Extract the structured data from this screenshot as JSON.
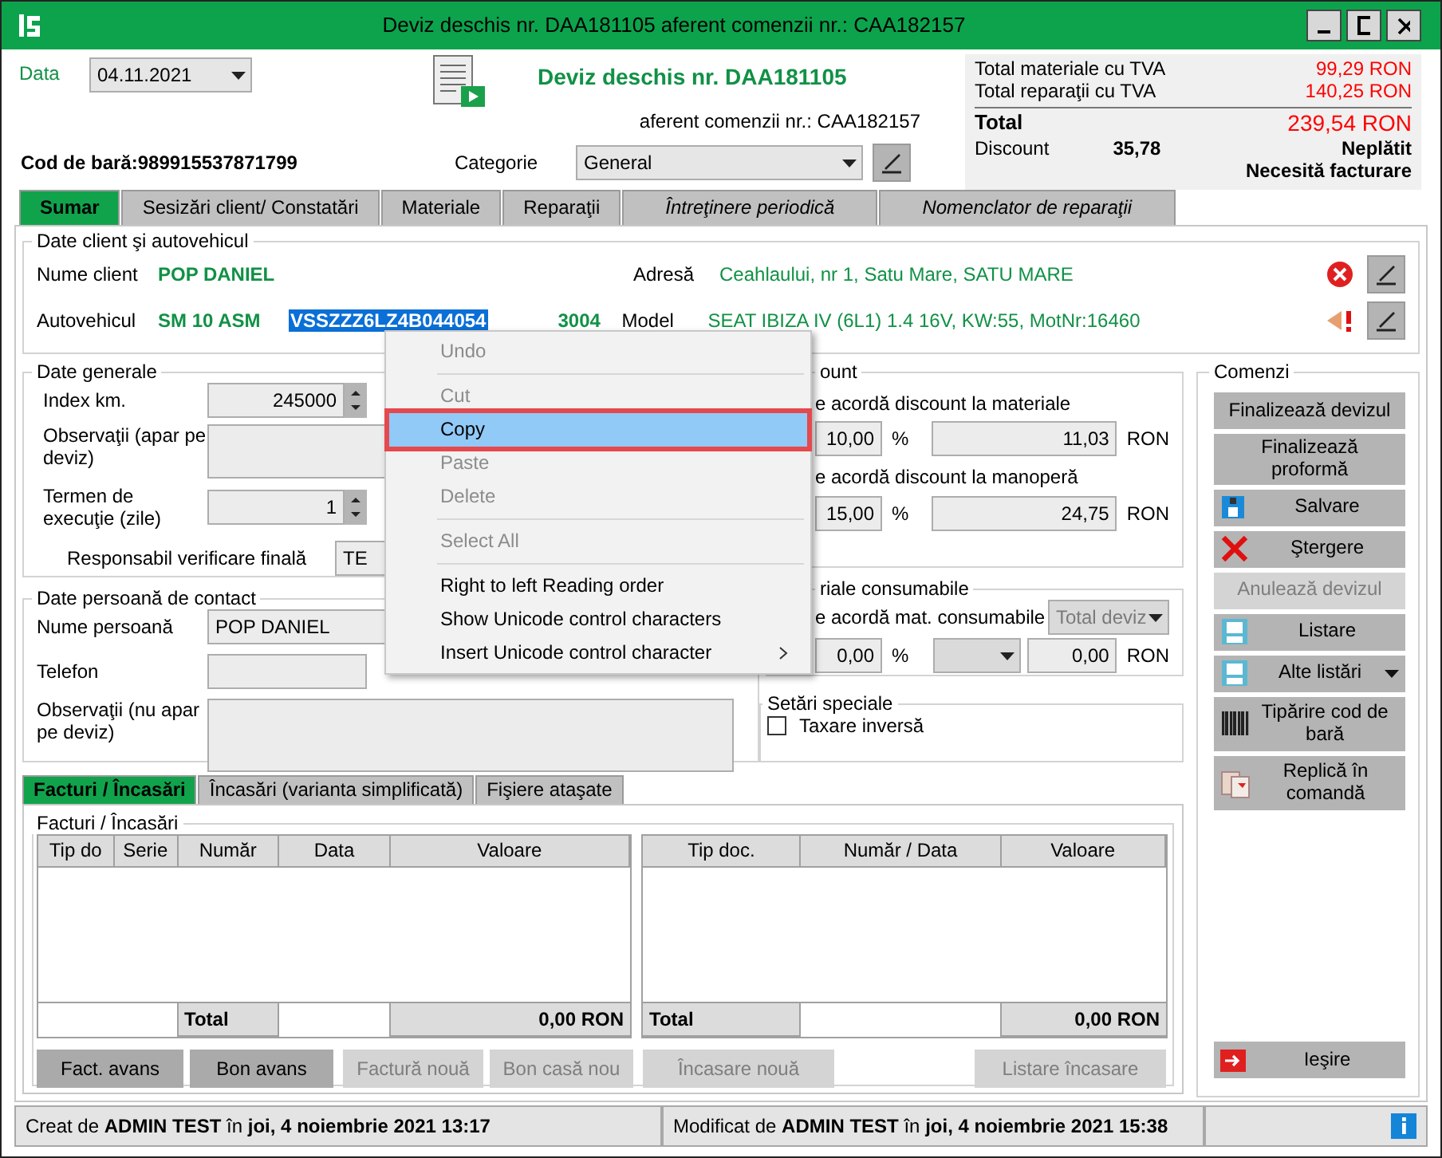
{
  "window": {
    "title": "Deviz deschis nr. DAA181105 aferent comenzii nr.: CAA182157"
  },
  "header": {
    "date_label": "Data",
    "date": "04.11.2021",
    "doc_title": "Deviz deschis nr. DAA181105",
    "order_ref": "aferent comenzii nr.: CAA182157",
    "barcode": "Cod de bară:989915537871799",
    "category_label": "Categorie",
    "category": "General"
  },
  "totals": {
    "rows": [
      {
        "label": "Total materiale cu TVA",
        "value": "99,29 RON"
      },
      {
        "label": "Total reparaţii cu TVA",
        "value": "140,25 RON"
      }
    ],
    "total_label": "Total",
    "total": "239,54 RON",
    "discount_label": "Discount",
    "discount": "35,78",
    "payment_status": "Neplătit",
    "invoice_note": "Necesită facturare"
  },
  "tabs": [
    {
      "label": "Sumar",
      "selected": true,
      "kind": "plain"
    },
    {
      "label": "Sesizări client/ Constatări",
      "selected": false,
      "kind": "plain"
    },
    {
      "label": "Materiale",
      "selected": false,
      "kind": "plain"
    },
    {
      "label": "Reparaţii",
      "selected": false,
      "kind": "plain"
    },
    {
      "label": "Întreţinere periodică",
      "selected": false,
      "kind": "italic"
    },
    {
      "label": "Nomenclator de reparaţii",
      "selected": false,
      "kind": "italic"
    }
  ],
  "client": {
    "title": "Date client şi autovehicul",
    "name_label": "Nume client",
    "name": "POP DANIEL",
    "address_label": "Adresă",
    "address": "Ceahlaului, nr 1, Satu Mare, SATU MARE",
    "vehicle_label": "Autovehicul",
    "plate": "SM 10 ASM",
    "vin": "VSSZZZ6LZ4B044054",
    "vin_selected": true,
    "year": "3004",
    "model_label": "Model",
    "model": "SEAT IBIZA IV (6L1) 1.4 16V, KW:55, MotNr:16460"
  },
  "general": {
    "title": "Date generale",
    "km_label": "Index km.",
    "km": "245000",
    "notes_label": "Observaţii (apar pe deviz)",
    "term_label": "Termen de execuţie (zile)",
    "term": "1",
    "checker_label": "Responsabil verificare finală",
    "checker": "TE"
  },
  "contact": {
    "title": "Date persoană de contact",
    "name_label": "Nume persoană",
    "name": "POP DANIEL",
    "phone_label": "Telefon",
    "notes_label": "Observaţii (nu apar pe deviz)"
  },
  "discount": {
    "title": "ount",
    "rows": [
      {
        "label": "e acordă discount la materiale",
        "percent": "10,00",
        "unit": "%",
        "amount": "11,03",
        "currency": "RON"
      },
      {
        "label": "e acordă discount la manoperă",
        "percent": "15,00",
        "unit": "%",
        "amount": "24,75",
        "currency": "RON"
      }
    ]
  },
  "consumables": {
    "title": "riale consumabile",
    "label": "e acordă mat. consumabile",
    "basis": "Total deviz",
    "percent": "0,00",
    "unit": "%",
    "amount": "0,00",
    "currency": "RON",
    "disabled": true
  },
  "special": {
    "title": "Setări speciale",
    "reverse_charge": {
      "label": "Taxare inversă",
      "checked": false
    }
  },
  "commands": {
    "title": "Comenzi",
    "buttons": [
      {
        "label": "Finalizează devizul",
        "kind": "plain",
        "disabled": false
      },
      {
        "label": "Finalizează proformă",
        "kind": "plain",
        "disabled": false
      },
      {
        "label": "Salvare",
        "kind": "save",
        "disabled": false
      },
      {
        "label": "Ştergere",
        "kind": "delete",
        "disabled": false
      },
      {
        "label": "Anulează devizul",
        "kind": "plain",
        "disabled": true
      },
      {
        "label": "Listare",
        "kind": "print",
        "disabled": false
      },
      {
        "label": "Alte listări",
        "kind": "print_menu",
        "disabled": false
      },
      {
        "label": "Tipărire cod de bară",
        "kind": "barcode",
        "disabled": false
      },
      {
        "label": "Replică în comandă",
        "kind": "copy",
        "disabled": false
      }
    ],
    "exit": {
      "label": "Ieşire"
    }
  },
  "bottom_tabs": [
    {
      "label": "Facturi / Încasări",
      "selected": true
    },
    {
      "label": "Încasări (varianta simplificată)",
      "selected": false
    },
    {
      "label": "Fişiere ataşate",
      "selected": false
    }
  ],
  "invoices": {
    "title": "Facturi / Încasări",
    "left_table": {
      "columns": [
        "Tip do",
        "Serie",
        "Număr",
        "Data",
        "Valoare"
      ],
      "total_label": "Total",
      "total": "0,00 RON"
    },
    "right_table": {
      "columns": [
        "Tip doc.",
        "Număr / Data",
        "Valoare"
      ],
      "total_label": "Total",
      "total": "0,00 RON"
    },
    "buttons": [
      {
        "label": "Fact. avans",
        "disabled": false
      },
      {
        "label": "Bon avans",
        "disabled": false
      },
      {
        "label": "Factură nouă",
        "disabled": true
      },
      {
        "label": "Bon casă nou",
        "disabled": true
      },
      {
        "label": "Încasare nouă",
        "disabled": true
      },
      {
        "label": "Listare încasare",
        "disabled": true
      }
    ]
  },
  "status_bar": {
    "created": "Creat de **ADMIN TEST** în **joi, 4 noiembrie 2021 13:17**",
    "modified": "Modificat de **ADMIN TEST** în **joi, 4 noiembrie 2021 15:38**"
  },
  "context_menu": {
    "items": [
      {
        "kind": "item",
        "label": "Undo",
        "disabled": true,
        "selected": false,
        "marked": false,
        "submenu": false
      },
      {
        "kind": "separator"
      },
      {
        "kind": "item",
        "label": "Cut",
        "disabled": true,
        "selected": false,
        "marked": false,
        "submenu": false
      },
      {
        "kind": "item",
        "label": "Copy",
        "disabled": false,
        "selected": true,
        "marked": true,
        "submenu": false
      },
      {
        "kind": "item",
        "label": "Paste",
        "disabled": true,
        "selected": false,
        "marked": false,
        "submenu": false
      },
      {
        "kind": "item",
        "label": "Delete",
        "disabled": true,
        "selected": false,
        "marked": false,
        "submenu": false
      },
      {
        "kind": "separator"
      },
      {
        "kind": "item",
        "label": "Select All",
        "disabled": true,
        "selected": false,
        "marked": false,
        "submenu": false
      },
      {
        "kind": "separator"
      },
      {
        "kind": "item",
        "label": "Right to left Reading order",
        "disabled": false,
        "selected": false,
        "marked": false,
        "submenu": false
      },
      {
        "kind": "item",
        "label": "Show Unicode control characters",
        "disabled": false,
        "selected": false,
        "marked": false,
        "submenu": false
      },
      {
        "kind": "item",
        "label": "Insert Unicode control character",
        "disabled": false,
        "selected": false,
        "marked": false,
        "submenu": true
      }
    ]
  }
}
